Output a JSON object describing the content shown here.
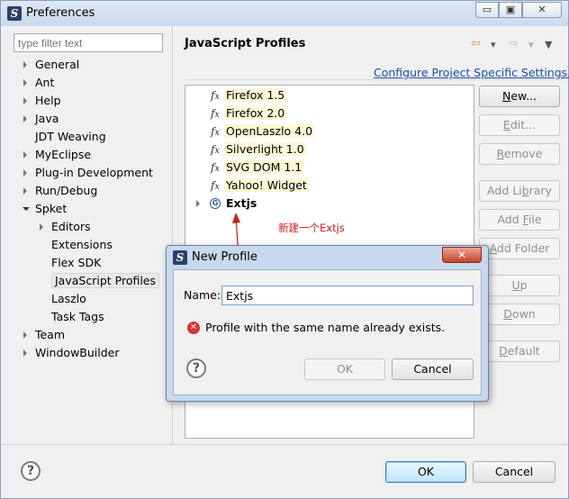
{
  "window": {
    "title": "Preferences",
    "minimize_glyph": "▭",
    "maximize_glyph": "▣",
    "close_glyph": "✕"
  },
  "filter": {
    "placeholder": "type filter text"
  },
  "sidebar": {
    "items": [
      {
        "label": "General",
        "expander": "collapsed"
      },
      {
        "label": "Ant",
        "expander": "collapsed"
      },
      {
        "label": "Help",
        "expander": "collapsed"
      },
      {
        "label": "Java",
        "expander": "collapsed"
      },
      {
        "label": "JDT Weaving",
        "expander": "none"
      },
      {
        "label": "MyEclipse",
        "expander": "collapsed"
      },
      {
        "label": "Plug-in Development",
        "expander": "collapsed"
      },
      {
        "label": "Run/Debug",
        "expander": "collapsed"
      },
      {
        "label": "Spket",
        "expander": "expanded"
      },
      {
        "label": "Editors",
        "expander": "collapsed"
      },
      {
        "label": "Extensions",
        "expander": "none"
      },
      {
        "label": "Flex SDK",
        "expander": "none"
      },
      {
        "label": "JavaScript Profiles",
        "expander": "none",
        "selected": true
      },
      {
        "label": "Laszlo",
        "expander": "none"
      },
      {
        "label": "Task Tags",
        "expander": "none"
      },
      {
        "label": "Team",
        "expander": "collapsed"
      },
      {
        "label": "WindowBuilder",
        "expander": "collapsed"
      }
    ]
  },
  "main": {
    "title": "JavaScript Profiles",
    "configure_link": "Configure Project Specific Settings...",
    "profiles": [
      {
        "label": "Firefox 1.5",
        "icon": "fx-icon"
      },
      {
        "label": "Firefox 2.0",
        "icon": "fx-icon"
      },
      {
        "label": "OpenLaszlo 4.0",
        "icon": "fx-icon"
      },
      {
        "label": "Silverlight 1.0",
        "icon": "fx-icon"
      },
      {
        "label": "SVG DOM 1.1",
        "icon": "fx-icon"
      },
      {
        "label": "Yahoo! Widget",
        "icon": "fx-icon"
      },
      {
        "label": "Extjs",
        "icon": "globe-icon",
        "bold": true
      }
    ],
    "buttons": {
      "new": {
        "label": "New...",
        "mnemonic": "N",
        "rest": "ew..."
      },
      "edit": {
        "label": "Edit...",
        "mnemonic": "E",
        "rest": "dit..."
      },
      "remove": {
        "label": "Remove",
        "mnemonic": "R",
        "rest": "emove"
      },
      "add_library": {
        "label": "Add Library",
        "pre": "Add Li",
        "mnemonic": "b",
        "rest": "rary"
      },
      "add_file": {
        "label": "Add File",
        "pre": "Add ",
        "mnemonic": "F",
        "rest": "ile"
      },
      "add_folder": {
        "label": "Add Folder",
        "pre": "",
        "mnemonic": "A",
        "rest": "dd Folder"
      },
      "up": {
        "label": "Up",
        "mnemonic": "U",
        "rest": "p"
      },
      "down": {
        "label": "Down",
        "mnemonic": "D",
        "rest": "own"
      },
      "default": {
        "label": "Default",
        "mnemonic": "D",
        "rest": "efault"
      }
    }
  },
  "annotation": "新建一个Extjs",
  "dialog": {
    "title": "New Profile",
    "close_glyph": "✕",
    "name_label": "Name:",
    "name_value": "Extjs",
    "error_message": "Profile with the same name already exists.",
    "ok_label": "OK",
    "cancel_label": "Cancel",
    "help_glyph": "?"
  },
  "footer": {
    "help_glyph": "?",
    "ok_label": "OK",
    "cancel_label": "Cancel"
  },
  "nav": {
    "back_glyph": "⇦",
    "fwd_glyph": "⇨",
    "dropdown_glyph": "▾",
    "menu_glyph": "▼"
  },
  "colors": {
    "link": "#1a4fa8",
    "annotation": "#d21a1a",
    "error": "#d9342a"
  }
}
